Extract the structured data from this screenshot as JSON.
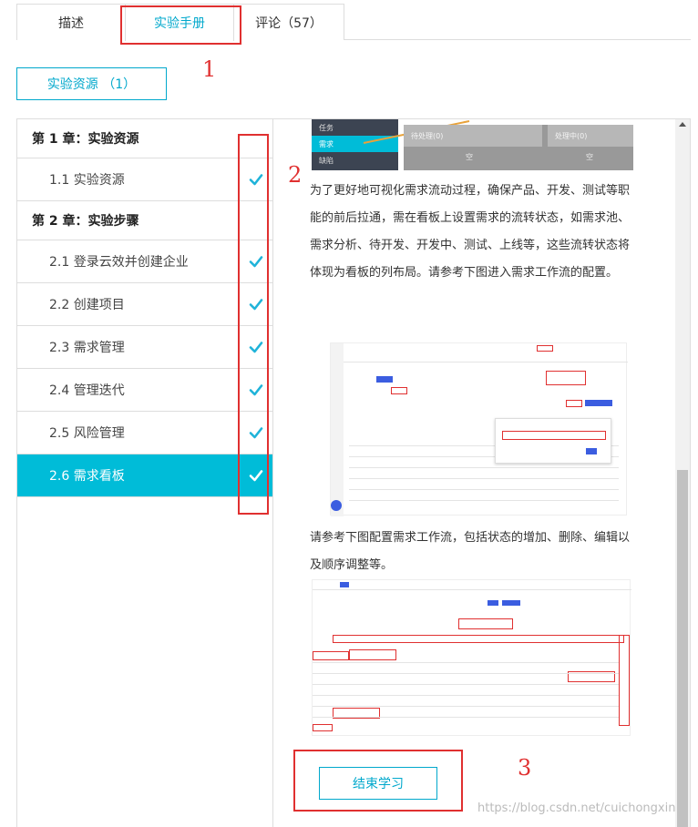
{
  "tabs": [
    {
      "label": "描述"
    },
    {
      "label": "实验手册"
    },
    {
      "label": "评论（57）"
    }
  ],
  "annotations": {
    "n1": "1",
    "n2": "2",
    "n3": "3"
  },
  "resource_button": "实验资源 （1）",
  "sidebar": {
    "items": [
      {
        "label": "第 1 章：实验资源",
        "kind": "chapter"
      },
      {
        "label": "1.1 实验资源",
        "kind": "sub",
        "done": true
      },
      {
        "label": "第 2 章：实验步骤",
        "kind": "chapter"
      },
      {
        "label": "2.1 登录云效并创建企业",
        "kind": "sub",
        "done": true
      },
      {
        "label": "2.2 创建项目",
        "kind": "sub",
        "done": true
      },
      {
        "label": "2.3 需求管理",
        "kind": "sub",
        "done": true
      },
      {
        "label": "2.4 管理迭代",
        "kind": "sub",
        "done": true
      },
      {
        "label": "2.5 风险管理",
        "kind": "sub",
        "done": true
      },
      {
        "label": "2.6 需求看板",
        "kind": "sub",
        "done": true,
        "active": true
      }
    ]
  },
  "content": {
    "top_shot": {
      "left_items": [
        "任务",
        "需求",
        "缺陷"
      ],
      "box1": "待处理(0)",
      "box2": "处理中(0)",
      "empty1": "空",
      "empty2": "空"
    },
    "para1": "为了更好地可视化需求流动过程，确保产品、开发、测试等职能的前后拉通，需在看板上设置需求的流转状态，如需求池、需求分析、待开发、开发中、测试、上线等，这些流转状态将体现为看板的列布局。请参考下图进入需求工作流的配置。",
    "para2": "请参考下图配置需求工作流，包括状态的增加、删除、编辑以及顺序调整等。",
    "end_button": "结束学习"
  },
  "watermark": "https://blog.csdn.net/cuichongxin",
  "colors": {
    "accent": "#00a8cc",
    "active_bg": "#00bcd8",
    "annotation_red": "#e03030"
  }
}
